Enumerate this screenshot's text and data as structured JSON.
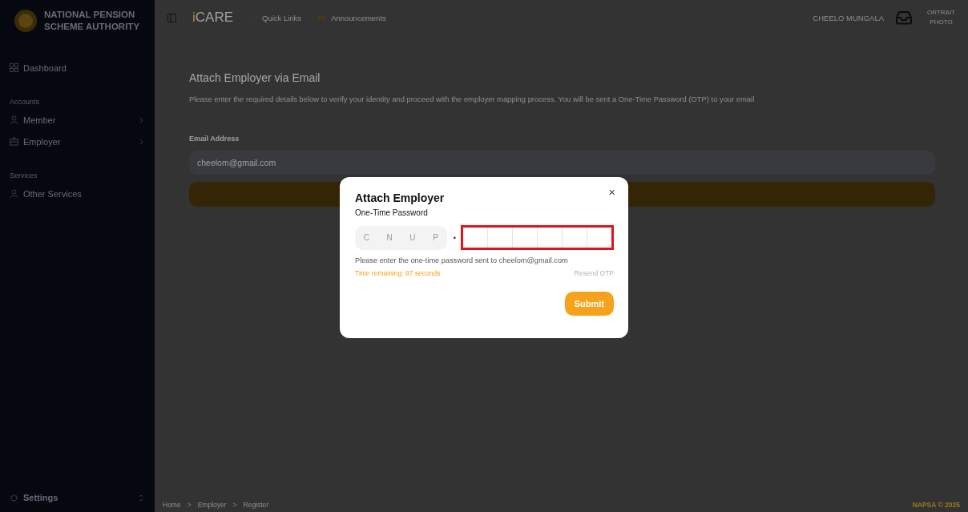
{
  "brand": {
    "name_line1": "NATIONAL PENSION",
    "name_line2": "SCHEME AUTHORITY"
  },
  "sidebar": {
    "items": [
      {
        "kind": "grid",
        "label": "Dashboard",
        "expandable": false
      },
      {
        "kind": "section",
        "label": "Accounts"
      },
      {
        "kind": "user",
        "label": "Member",
        "expandable": true
      },
      {
        "kind": "case",
        "label": "Employer",
        "expandable": true
      },
      {
        "kind": "section",
        "label": "Services"
      },
      {
        "kind": "user",
        "label": "Other Services",
        "expandable": false
      }
    ],
    "settings": "Settings"
  },
  "header": {
    "logo_prefix": "i",
    "logo": "CARE",
    "links": [
      {
        "label": "Quick Links"
      },
      {
        "label": "Announcements"
      }
    ],
    "user": "CHEELO MUNGALA",
    "photo_alt_line1": "ORTRAIT",
    "photo_alt_line2": "PHOTO"
  },
  "page": {
    "title": "Attach Employer via Email",
    "description": "Please enter the required details below to verify your identity and proceed with the employer mapping process. You will be sent a One-Time Password (OTP) to your email",
    "email_label": "Email Address",
    "email_value": "cheelom@gmail.com"
  },
  "modal": {
    "title": "Attach Employer",
    "subtitle": "One-Time Password",
    "prefix": [
      "C",
      "N",
      "U",
      "P"
    ],
    "separator": "•",
    "highlighted": true,
    "hint": "Please enter the one-time password sent to cheelom@gmail.com",
    "timer": "Time remaining: 97 seconds",
    "resend": "Resend OTP",
    "resend_disabled": true,
    "submit": "Submit",
    "close": "×"
  },
  "breadcrumb": [
    {
      "label": "Home"
    },
    {
      "separator": ">",
      "label": "Employer"
    },
    {
      "separator": ">",
      "label": "Register"
    }
  ],
  "copyright": "NAPSA © 2025"
}
